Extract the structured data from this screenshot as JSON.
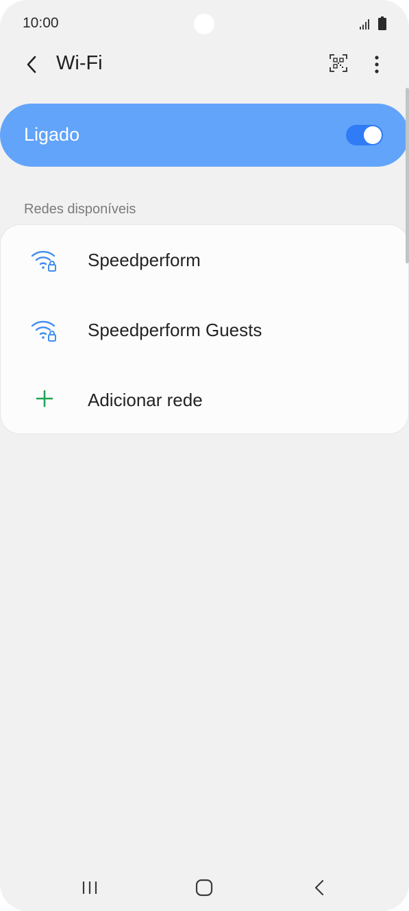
{
  "status_bar": {
    "time": "10:00",
    "signal_icon": "signal-icon",
    "battery_icon": "battery-icon"
  },
  "header": {
    "title": "Wi-Fi",
    "back_icon": "chevron-left-icon",
    "qr_icon": "qr-code-scanner-icon",
    "more_icon": "more-vertical-icon"
  },
  "master_switch": {
    "label": "Ligado",
    "enabled": true
  },
  "networks_section": {
    "header": "Redes disponíveis",
    "items": [
      {
        "label": "Speedperform",
        "icon": "wifi-locked-icon"
      },
      {
        "label": "Speedperform Guests",
        "icon": "wifi-locked-icon"
      },
      {
        "label": "Adicionar rede",
        "icon": "plus-icon"
      }
    ]
  },
  "nav_bar": {
    "recents_icon": "recents-icon",
    "home_icon": "home-icon",
    "back_icon": "back-icon"
  },
  "colors": {
    "background": "#f1f1f1",
    "switch_bar": "#62a4fa",
    "toggle_track": "#2f7cf6",
    "wifi_icon": "#3f8cf2",
    "plus_icon": "#1ea353",
    "text_primary": "#232323",
    "text_secondary": "#7b7b7b"
  }
}
